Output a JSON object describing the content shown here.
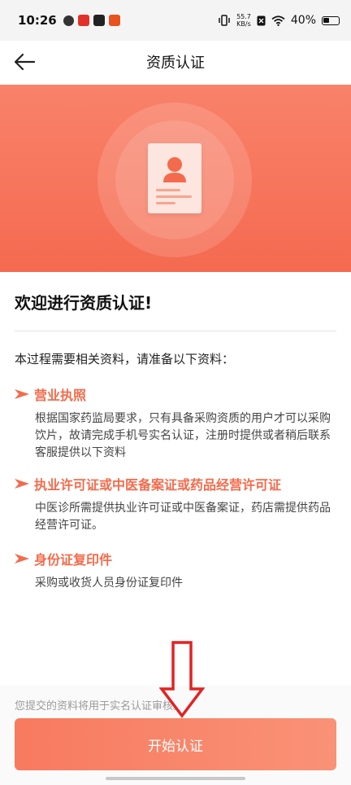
{
  "status_bar": {
    "time": "10:26",
    "net_speed_value": "55.7",
    "net_speed_unit": "KB/s",
    "battery": "40%"
  },
  "header": {
    "title": "资质认证",
    "back_icon": "arrow-left-icon"
  },
  "banner": {
    "illustration_icon": "id-card-icon",
    "accent_color": "#f46a50"
  },
  "content": {
    "welcome": "欢迎进行资质认证!",
    "intro": "本过程需要相关资料，请准备以下资料：",
    "sections": [
      {
        "title": "营业执照",
        "desc": "根据国家药监局要求，只有具备采购资质的用户才可以采购饮片，故请完成手机号实名认证，注册时提供或者稍后联系客服提供以下资料"
      },
      {
        "title": "执业许可证或中医备案证或药品经营许可证",
        "desc": "中医诊所需提供执业许可证或中医备案证，药店需提供药品经营许可证。"
      },
      {
        "title": "身份证复印件",
        "desc": "采购或收货人员身份证复印件"
      }
    ]
  },
  "footer": {
    "notice": "您提交的资料将用于实名认证审核。",
    "start_button": "开始认证"
  }
}
